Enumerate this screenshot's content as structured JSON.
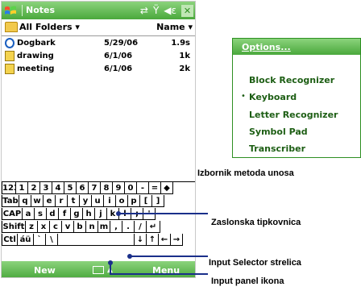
{
  "window": {
    "title": "Notes",
    "status_icons": [
      "connectivity-icon",
      "signal-icon",
      "volume-icon"
    ],
    "close_label": "✕"
  },
  "folderbar": {
    "folder": "All Folders ▾",
    "sort": "Name ▾"
  },
  "files": [
    {
      "name": "Dogbark",
      "date": "5/29/06",
      "size": "1.9s",
      "icon": "recording-icon"
    },
    {
      "name": "drawing",
      "date": "6/1/06",
      "size": "1k",
      "icon": "note-icon"
    },
    {
      "name": "meeting",
      "date": "6/1/06",
      "size": "2k",
      "icon": "note-icon"
    }
  ],
  "keyboard": {
    "row1": [
      "123",
      "1",
      "2",
      "3",
      "4",
      "5",
      "6",
      "7",
      "8",
      "9",
      "0",
      "-",
      "=",
      "◆"
    ],
    "row2": [
      "Tab",
      "q",
      "w",
      "e",
      "r",
      "t",
      "y",
      "u",
      "i",
      "o",
      "p",
      "[",
      "]"
    ],
    "row3": [
      "CAP",
      "a",
      "s",
      "d",
      "f",
      "g",
      "h",
      "j",
      "k",
      "l",
      ";",
      "'"
    ],
    "row4": [
      "Shift",
      "z",
      "x",
      "c",
      "v",
      "b",
      "n",
      "m",
      ",",
      ".",
      "/",
      "↵"
    ],
    "row5": [
      "Ctl",
      "áü",
      "`",
      "\\",
      "",
      "↓",
      "↑",
      "←",
      "→"
    ]
  },
  "menubar": {
    "left": "New",
    "right": "Menu"
  },
  "popup": {
    "header": "Options...",
    "items": [
      {
        "label": "Block Recognizer",
        "selected": false
      },
      {
        "label": "Keyboard",
        "selected": true
      },
      {
        "label": "Letter Recognizer",
        "selected": false
      },
      {
        "label": "Symbol Pad",
        "selected": false
      },
      {
        "label": "Transcriber",
        "selected": false
      }
    ],
    "bullet": "•"
  },
  "captions": {
    "popup": "Izbornik metoda unosa",
    "keyboard": "Zaslonska tipkovnica",
    "selector": "Input Selector strelica",
    "panel": "Input panel ikona"
  },
  "colors": {
    "accent_green": "#4aa83c",
    "menu_text": "#1d5e14"
  }
}
